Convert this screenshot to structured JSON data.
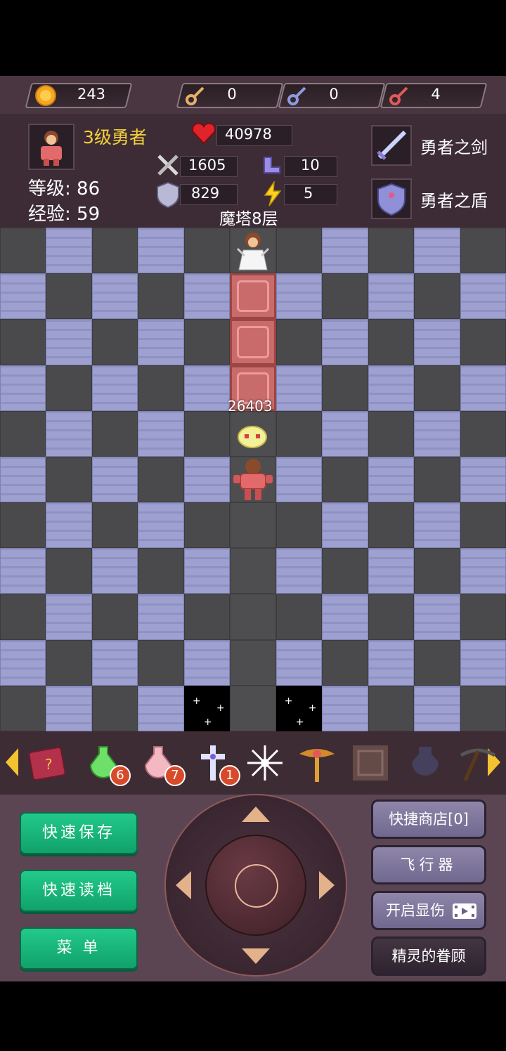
{
  "resources": {
    "gold": "243",
    "yellow_keys": "0",
    "blue_keys": "0",
    "red_keys": "4"
  },
  "hero": {
    "title": "3级勇者",
    "level_label": "等级: 86",
    "exp_label": "经验: 59",
    "hp": "40978",
    "attack": "1605",
    "defense": "829",
    "magic_def": "10",
    "speed": "5",
    "weapon": "勇者之剑",
    "shield": "勇者之盾"
  },
  "floor_label": "魔塔8层",
  "damage_label": "26403",
  "items": [
    {
      "name": "monster-manual",
      "count": ""
    },
    {
      "name": "green-potion",
      "count": "6"
    },
    {
      "name": "pink-potion",
      "count": "7"
    },
    {
      "name": "cross",
      "count": "1"
    },
    {
      "name": "snowflake",
      "count": ""
    },
    {
      "name": "winged-staff",
      "count": ""
    },
    {
      "name": "red-door",
      "count": ""
    },
    {
      "name": "blue-vase",
      "count": ""
    },
    {
      "name": "pickaxe",
      "count": ""
    }
  ],
  "buttons": {
    "quick_save": "快速保存",
    "quick_load": "快速读档",
    "menu": "菜 单",
    "shop": "快捷商店[0]",
    "fly": "飞行器",
    "show_damage": "开启显伤",
    "fairy": "精灵的眷顾"
  },
  "colors": {
    "green_button": "#1ab87c",
    "purple_button": "#7d7599",
    "panel_bg": "#3d2c36"
  }
}
